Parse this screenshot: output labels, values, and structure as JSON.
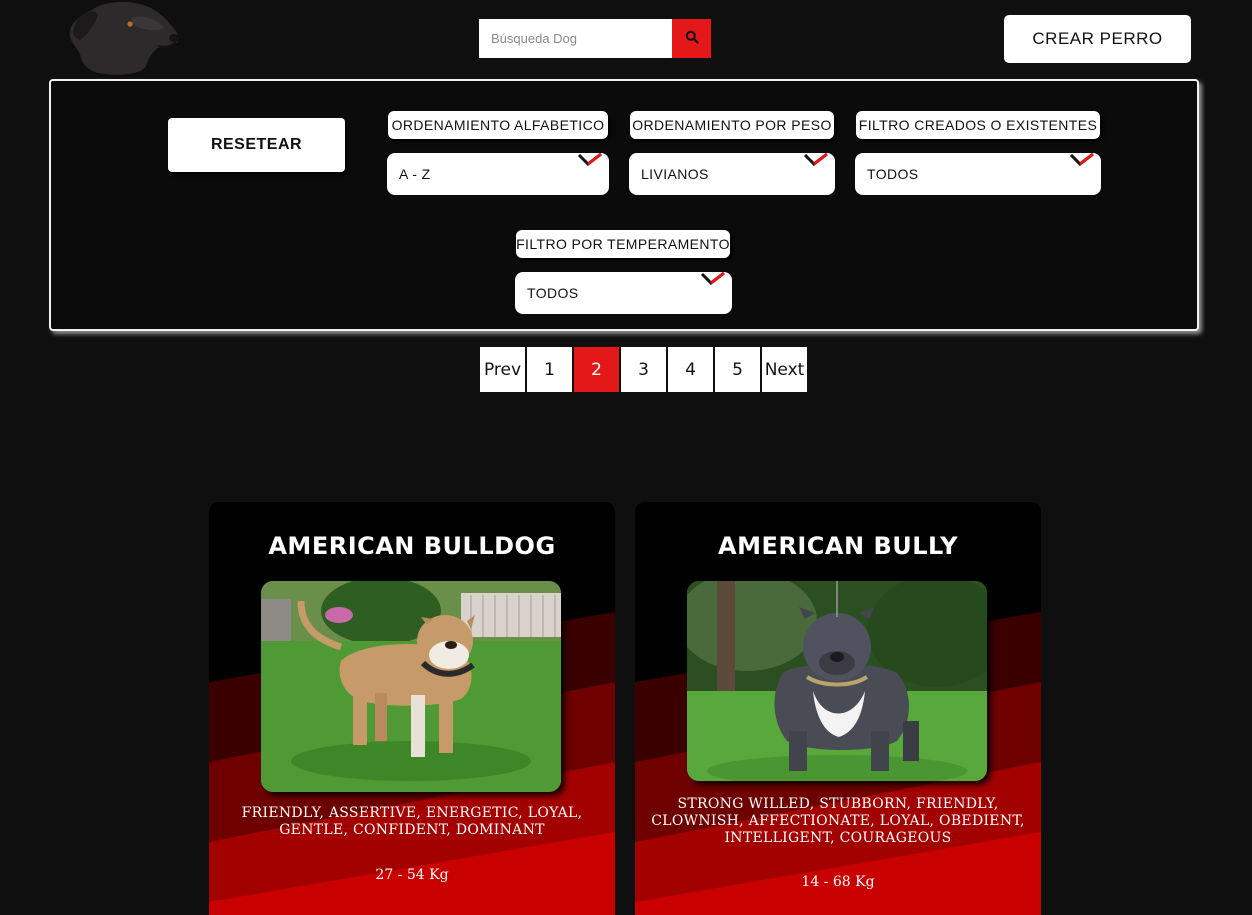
{
  "header": {
    "search_placeholder": "Búsqueda Dog",
    "create_label": "CREAR PERRO"
  },
  "filters": {
    "reset_label": "RESETEAR",
    "alpha": {
      "label": "ORDENAMIENTO ALFABETICO",
      "value": "A - Z"
    },
    "weight": {
      "label": "ORDENAMIENTO POR PESO",
      "value": "LIVIANOS"
    },
    "source": {
      "label": "FILTRO CREADOS O EXISTENTES",
      "value": "TODOS"
    },
    "temperament": {
      "label": "FILTRO POR TEMPERAMENTO",
      "value": "TODOS"
    }
  },
  "pagination": {
    "prev_label": "Prev",
    "next_label": "Next",
    "pages": [
      "1",
      "2",
      "3",
      "4",
      "5"
    ],
    "current": "2"
  },
  "cards": [
    {
      "name": "AMERICAN BULLDOG",
      "temperaments": "FRIENDLY, ASSERTIVE, ENERGETIC, LOYAL, GENTLE, CONFIDENT, DOMINANT",
      "weight": "27 - 54 Kg"
    },
    {
      "name": "AMERICAN BULLY",
      "temperaments": "STRONG WILLED, STUBBORN, FRIENDLY, CLOWNISH, AFFECTIONATE, LOYAL, OBEDIENT, INTELLIGENT, COURAGEOUS",
      "weight": "14 - 68 Kg"
    }
  ],
  "colors": {
    "accent_red": "#e41818",
    "background": "#0f0f0f",
    "card_red": "#c40000"
  }
}
